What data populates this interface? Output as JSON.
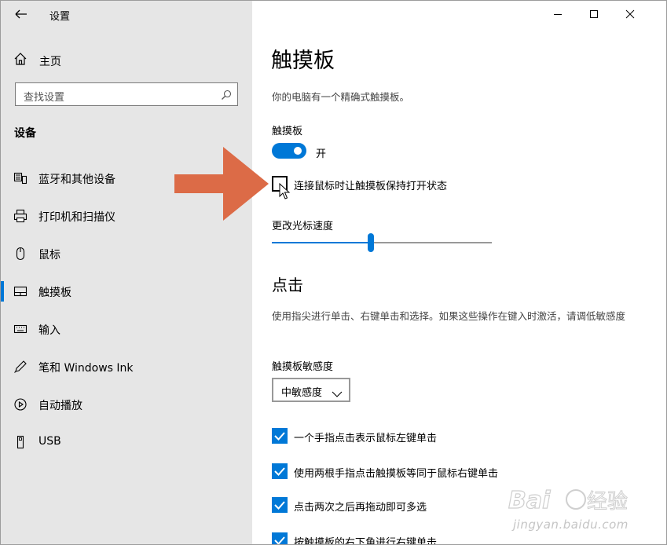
{
  "app": {
    "title": "设置"
  },
  "window_controls": {
    "minimize": "minimize",
    "maximize": "maximize",
    "close": "close"
  },
  "sidebar": {
    "home_label": "主页",
    "search_placeholder": "查找设置",
    "section_title": "设备",
    "items": [
      {
        "label": "蓝牙和其他设备",
        "icon": "bluetooth-devices-icon",
        "selected": false
      },
      {
        "label": "打印机和扫描仪",
        "icon": "printer-icon",
        "selected": false
      },
      {
        "label": "鼠标",
        "icon": "mouse-icon",
        "selected": false
      },
      {
        "label": "触摸板",
        "icon": "touchpad-icon",
        "selected": true
      },
      {
        "label": "输入",
        "icon": "keyboard-icon",
        "selected": false
      },
      {
        "label": "笔和 Windows Ink",
        "icon": "pen-icon",
        "selected": false
      },
      {
        "label": "自动播放",
        "icon": "autoplay-icon",
        "selected": false
      },
      {
        "label": "USB",
        "icon": "usb-icon",
        "selected": false
      }
    ]
  },
  "main": {
    "title": "触摸板",
    "description": "你的电脑有一个精确式触摸板。",
    "touchpad_label": "触摸板",
    "toggle_state": "开",
    "toggle_on": true,
    "keep_on_label": "连接鼠标时让触摸板保持打开状态",
    "keep_on_checked": false,
    "cursor_speed_label": "更改光标速度",
    "cursor_speed_value": 0.45,
    "taps_title": "点击",
    "taps_description": "使用指尖进行单击、右键单击和选择。如果这些操作在键入时激活，请调低敏感度",
    "sensitivity_label": "触摸板敏感度",
    "sensitivity_value": "中敏感度",
    "checkboxes": [
      {
        "label": "一个手指点击表示鼠标左键单击",
        "checked": true
      },
      {
        "label": "使用两根手指点击触摸板等同于鼠标右键单击",
        "checked": true
      },
      {
        "label": "点击两次之后再拖动即可多选",
        "checked": true
      },
      {
        "label": "按触摸板的右下角进行右键单击",
        "checked": true
      }
    ]
  },
  "colors": {
    "accent": "#0078d7",
    "sidebar_bg": "#e6e6e6",
    "annotation_arrow": "#dc6b47"
  },
  "watermark": {
    "text": "jingyan.baidu.com"
  }
}
